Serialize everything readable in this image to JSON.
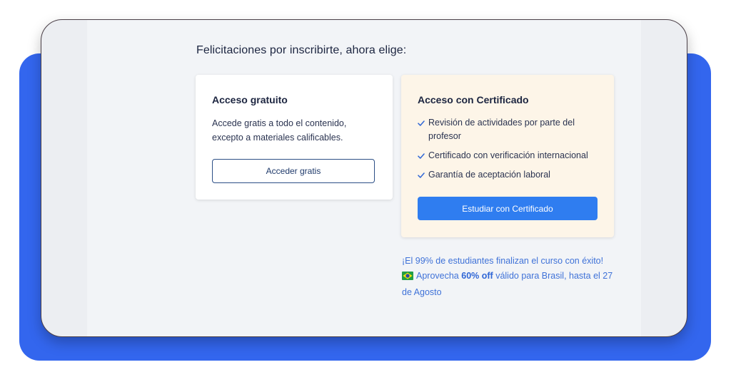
{
  "colors": {
    "backdrop": "#3366ee",
    "primary_button": "#2f7df0",
    "promo_text": "#3f72d8",
    "cert_card_bg": "#fdf5e8"
  },
  "heading": "Felicitaciones por inscribirte, ahora elige:",
  "free_card": {
    "title": "Acceso gratuito",
    "description": "Accede gratis a todo el contenido, excepto a materiales calificables.",
    "button_label": "Acceder gratis"
  },
  "cert_card": {
    "title": "Acceso con Certificado",
    "features": [
      "Revisión de actividades por parte del profesor",
      "Certificado con verificación internacional",
      "Garantía de aceptación laboral"
    ],
    "button_label": "Estudiar con Certificado"
  },
  "promo": {
    "completion_text": "¡El 99% de estudiantes finalizan el curso con éxito!",
    "flag_icon": "brazil-flag-icon",
    "offer_prefix": "Aprovecha",
    "offer_highlight": "60% off",
    "offer_suffix": "válido para Brasil, hasta el 27 de Agosto"
  }
}
